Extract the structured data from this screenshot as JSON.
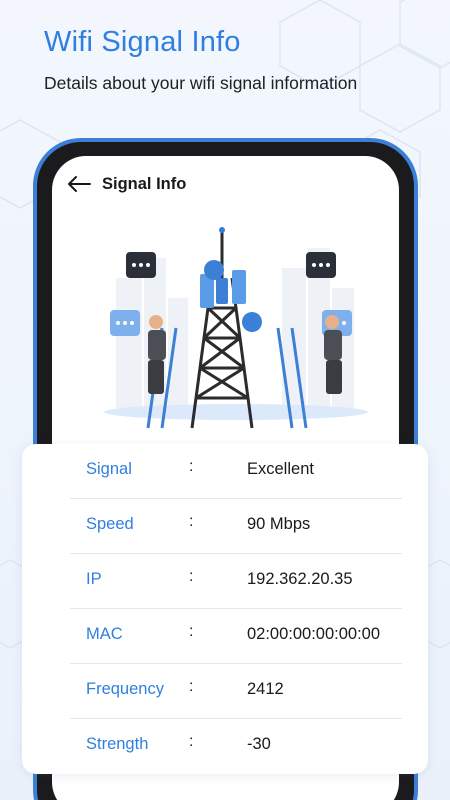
{
  "promo": {
    "title": "Wifi Signal Info",
    "subtitle": "Details about your wifi signal information"
  },
  "appbar": {
    "back_icon": "arrow-left-icon",
    "title": "Signal Info"
  },
  "info_rows": [
    {
      "label": "Signal",
      "value": "Excellent"
    },
    {
      "label": "Speed",
      "value": "90 Mbps"
    },
    {
      "label": "IP",
      "value": "192.362.20.35"
    },
    {
      "label": "MAC",
      "value": "02:00:00:00:00:00"
    },
    {
      "label": "Frequency",
      "value": "2412"
    },
    {
      "label": "Strength",
      "value": "-30"
    }
  ],
  "colon": ":",
  "colors": {
    "accent": "#2f7fe0",
    "phone_frame": "#3b7fd6",
    "phone_body": "#1b1b1d"
  }
}
